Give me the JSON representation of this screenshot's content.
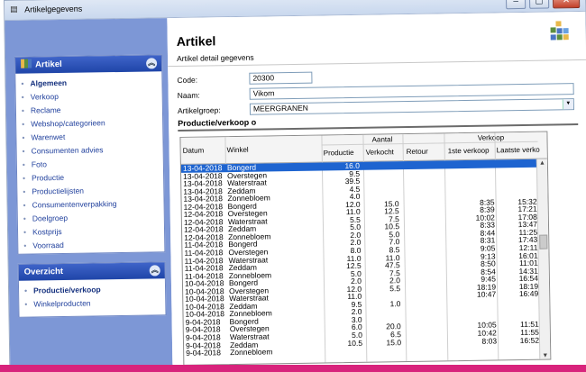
{
  "window": {
    "title": "Artikelgegevens",
    "min": "‒",
    "max": "▢",
    "close": "✕"
  },
  "sidebar": {
    "artikel": {
      "title": "Artikel",
      "items": [
        "Algemeen",
        "Verkoop",
        "Reclame",
        "Webshop/categorieen",
        "Warenwet",
        "Consumenten advies",
        "Foto",
        "Productie",
        "Productielijsten",
        "Consumentenverpakking",
        "Doelgroep",
        "Kostprijs",
        "Voorraad"
      ]
    },
    "overzicht": {
      "title": "Overzicht",
      "items": [
        "Productie/verkoop",
        "Winkelproducten"
      ]
    }
  },
  "main": {
    "title": "Artikel",
    "subtitle": "Artikel detail gegevens",
    "form": {
      "code_label": "Code:",
      "code_value": "20300",
      "naam_label": "Naam:",
      "naam_value": "Vikorn",
      "groep_label": "Artikelgroep:",
      "groep_value": "MEERGRANEN"
    },
    "section": "Productie/verkoop o",
    "grid": {
      "group_aantal": "Aantal",
      "group_verkoop": "Verkoop",
      "headers": {
        "datum": "Datum",
        "winkel": "Winkel",
        "productie": "Productie",
        "verkocht": "Verkocht",
        "retour": "Retour",
        "eerste": "1ste verkoop",
        "laatste": "Laatste verko"
      },
      "rows": [
        [
          "13-04-2018",
          "Bongerd",
          "16.0",
          "",
          "",
          "",
          ""
        ],
        [
          "13-04-2018",
          "Overstegen",
          "9.5",
          "",
          "",
          "",
          ""
        ],
        [
          "13-04-2018",
          "Waterstraat",
          "39.5",
          "",
          "",
          "",
          ""
        ],
        [
          "13-04-2018",
          "Zeddam",
          "4.5",
          "",
          "",
          "",
          ""
        ],
        [
          "13-04-2018",
          "Zonnebloem",
          "4.0",
          "",
          "",
          "",
          ""
        ],
        [
          "12-04-2018",
          "Bongerd",
          "12.0",
          "15.0",
          "",
          "8:35",
          "15:32"
        ],
        [
          "12-04-2018",
          "Overstegen",
          "11.0",
          "12.5",
          "",
          "8:39",
          "17:21"
        ],
        [
          "12-04-2018",
          "Waterstraat",
          "5.5",
          "7.5",
          "",
          "10:02",
          "17:08"
        ],
        [
          "12-04-2018",
          "Zeddam",
          "5.0",
          "10.5",
          "",
          "8:33",
          "13:47"
        ],
        [
          "12-04-2018",
          "Zonnebloem",
          "2.0",
          "5.0",
          "",
          "8:44",
          "11:25"
        ],
        [
          "11-04-2018",
          "Bongerd",
          "2.0",
          "7.0",
          "",
          "8:31",
          "17:43"
        ],
        [
          "11-04-2018",
          "Overstegen",
          "8.0",
          "8.5",
          "",
          "9:05",
          "12:11"
        ],
        [
          "11-04-2018",
          "Waterstraat",
          "11.0",
          "11.0",
          "",
          "9:13",
          "16:01"
        ],
        [
          "11-04-2018",
          "Zeddam",
          "12.5",
          "47.5",
          "",
          "8:50",
          "11:01"
        ],
        [
          "11-04-2018",
          "Zonnebloem",
          "5.0",
          "7.5",
          "",
          "8:54",
          "14:31"
        ],
        [
          "10-04-2018",
          "Bongerd",
          "2.0",
          "2.0",
          "",
          "9:45",
          "16:54"
        ],
        [
          "10-04-2018",
          "Overstegen",
          "12.0",
          "5.5",
          "",
          "18:19",
          "18:19"
        ],
        [
          "10-04-2018",
          "Waterstraat",
          "11.0",
          "",
          "",
          "10:47",
          "16:49"
        ],
        [
          "10-04-2018",
          "Zeddam",
          "9.5",
          "1.0",
          "",
          "",
          ""
        ],
        [
          "10-04-2018",
          "Zonnebloem",
          "2.0",
          "",
          "",
          "",
          ""
        ],
        [
          "9-04-2018",
          "Bongerd",
          "3.0",
          "",
          "",
          "",
          ""
        ],
        [
          "9-04-2018",
          "Overstegen",
          "6.0",
          "20.0",
          "",
          "10:05",
          "11:51"
        ],
        [
          "9-04-2018",
          "Waterstraat",
          "5.0",
          "6.5",
          "",
          "10:42",
          "11:55"
        ],
        [
          "9-04-2018",
          "Zeddam",
          "10.5",
          "15.0",
          "",
          "8:03",
          "16:52"
        ],
        [
          "9-04-2018",
          "Zonnebloem",
          "",
          "",
          "",
          "",
          ""
        ]
      ]
    }
  }
}
